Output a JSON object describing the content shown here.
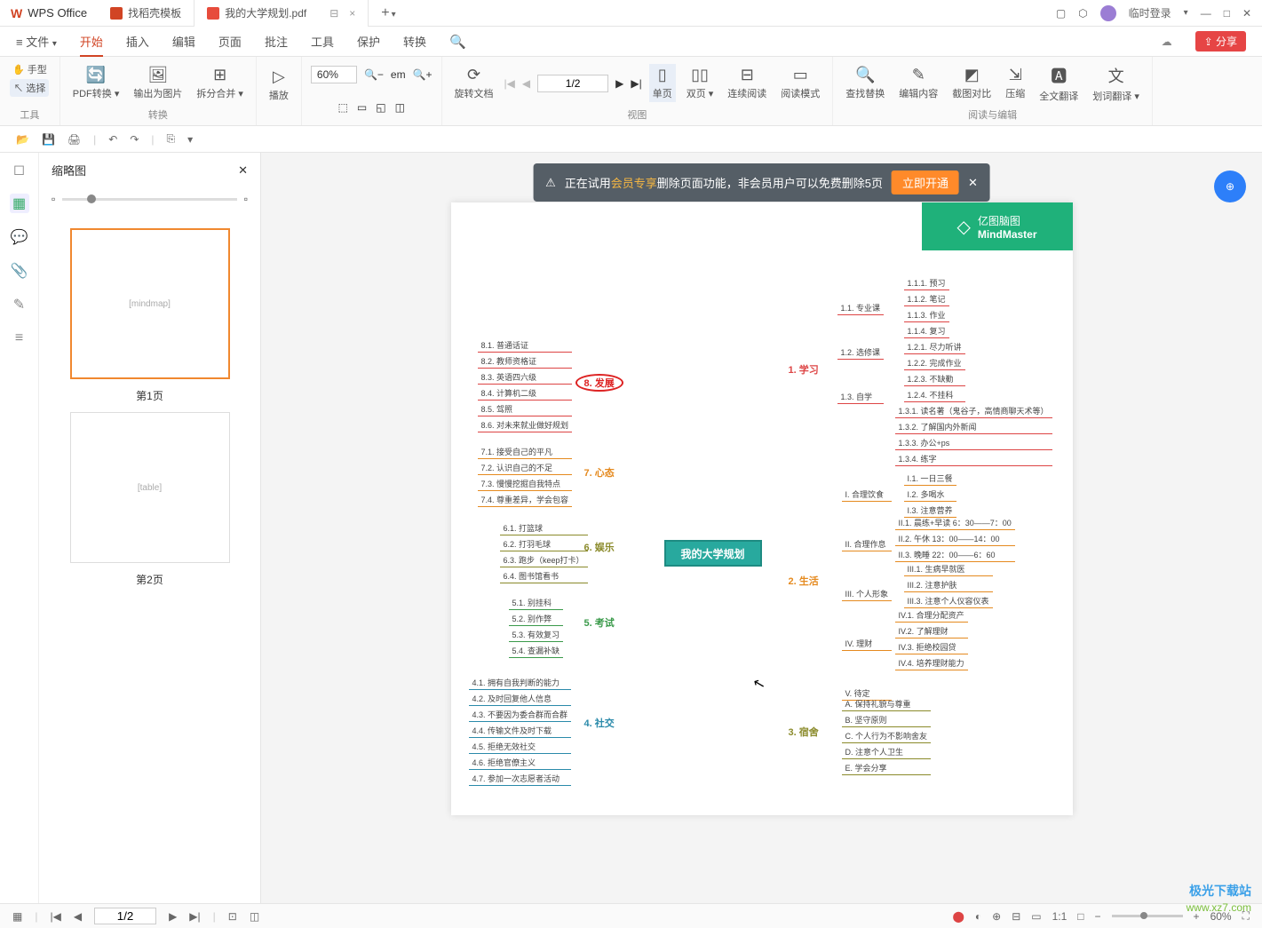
{
  "app": {
    "name": "WPS Office"
  },
  "tabs": [
    {
      "label": "找稻壳模板"
    },
    {
      "label": "我的大学规划.pdf",
      "active": true
    }
  ],
  "titleRight": {
    "login": "临时登录"
  },
  "filemenu": "文件",
  "menus": [
    "开始",
    "插入",
    "编辑",
    "页面",
    "批注",
    "工具",
    "保护",
    "转换"
  ],
  "share": "分享",
  "ribbon": {
    "tools": {
      "hand": "手型",
      "select": "选择",
      "group": "工具"
    },
    "convert": {
      "pdfconv": "PDF转换",
      "exportimg": "输出为图片",
      "split": "拆分合并",
      "group": "转换"
    },
    "play": {
      "play": "播放"
    },
    "view": {
      "zoom": "60%",
      "rotate": "旋转文档",
      "single": "单页",
      "double": "双页",
      "continuous": "连续阅读",
      "readmode": "阅读模式",
      "group": "视图",
      "page": "1/2"
    },
    "edit": {
      "findreplace": "查找替换",
      "editcontent": "编辑内容",
      "screenshot": "截图对比",
      "compress": "压缩",
      "fulltrans": "全文翻译",
      "wordtrans": "划词翻译",
      "group": "阅读与编辑"
    }
  },
  "thumbpanel": {
    "title": "缩略图",
    "page1": "第1页",
    "page2": "第2页"
  },
  "banner": {
    "pre": "正在试用",
    "vip": "会员专享",
    "post": "删除页面功能，非会员用户可以免费删除5页",
    "btn": "立即开通"
  },
  "mm": {
    "logo1": "亿图脑图",
    "logo2": "MindMaster",
    "center": "我的大学规划",
    "left": {
      "b8": {
        "label": "8. 发展",
        "items": [
          "8.1. 普通话证",
          "8.2. 教师资格证",
          "8.3. 英语四六级",
          "8.4. 计算机二级",
          "8.5. 驾照",
          "8.6. 对未来就业做好规划"
        ]
      },
      "b7": {
        "label": "7. 心态",
        "items": [
          "7.1. 接受自己的平凡",
          "7.2. 认识自己的不足",
          "7.3. 慢慢挖掘自我特点",
          "7.4. 尊重差异，学会包容"
        ]
      },
      "b6": {
        "label": "6. 娱乐",
        "items": [
          "6.1. 打篮球",
          "6.2. 打羽毛球",
          "6.3. 跑步（keep打卡）",
          "6.4. 图书馆看书"
        ]
      },
      "b5": {
        "label": "5. 考试",
        "items": [
          "5.1. 别挂科",
          "5.2. 别作弊",
          "5.3. 有效复习",
          "5.4. 查漏补缺"
        ]
      },
      "b4": {
        "label": "4. 社交",
        "items": [
          "4.1. 拥有自我判断的能力",
          "4.2. 及时回复他人信息",
          "4.3. 不要因为委合群而合群",
          "4.4. 传输文件及时下载",
          "4.5. 拒绝无效社交",
          "4.6. 拒绝官僚主义",
          "4.7. 参加一次志愿者活动"
        ]
      }
    },
    "right": {
      "b1": {
        "label": "1. 学习",
        "sub": [
          {
            "label": "1.1. 专业课",
            "items": [
              "1.1.1. 预习",
              "1.1.2. 笔记",
              "1.1.3. 作业",
              "1.1.4. 复习"
            ]
          },
          {
            "label": "1.2. 选修课",
            "items": [
              "1.2.1. 尽力听讲",
              "1.2.2. 完成作业",
              "1.2.3. 不缺勤",
              "1.2.4. 不挂科"
            ]
          },
          {
            "label": "1.3. 自学",
            "items": [
              "1.3.1. 读名著（鬼谷子，高情商聊天术等）",
              "1.3.2. 了解国内外新闻",
              "1.3.3. 办公+ps",
              "1.3.4. 练字"
            ]
          }
        ]
      },
      "b2": {
        "label": "2. 生活",
        "sub": [
          {
            "label": "I. 合理饮食",
            "items": [
              "I.1. 一日三餐",
              "I.2. 多喝水",
              "I.3. 注意营养"
            ]
          },
          {
            "label": "II. 合理作息",
            "items": [
              "II.1. 晨练+早读 6：30——7：00",
              "II.2. 午休 13：00——14：00",
              "II.3. 晚睡 22：00——6：60"
            ]
          },
          {
            "label": "III. 个人形象",
            "items": [
              "III.1. 生病早就医",
              "III.2. 注意护肤",
              "III.3. 注意个人仪容仪表"
            ]
          },
          {
            "label": "IV. 理财",
            "items": [
              "IV.1. 合理分配资产",
              "IV.2. 了解理财",
              "IV.3. 拒绝校园贷",
              "IV.4. 培养理财能力"
            ]
          },
          {
            "label": "V. 待定",
            "items": []
          }
        ]
      },
      "b3": {
        "label": "3. 宿舍",
        "items": [
          "A. 保持礼貌与尊重",
          "B. 坚守原则",
          "C. 个人行为不影响舍友",
          "D. 注意个人卫生",
          "E. 学会分享"
        ]
      }
    }
  },
  "status": {
    "page": "1/2",
    "zoom": "60%"
  },
  "watermark": {
    "l1": "极光下载站",
    "l2": "www.xz7.com"
  }
}
